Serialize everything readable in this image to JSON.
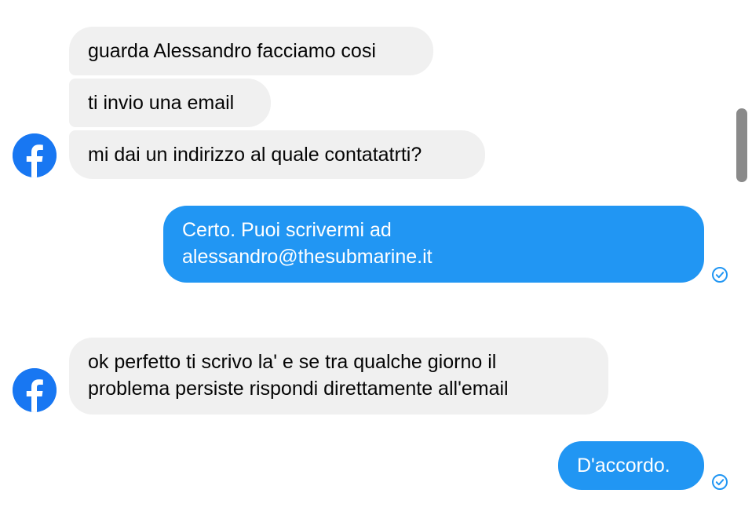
{
  "thread": {
    "messages": [
      {
        "from": "other",
        "text": "guarda Alessandro facciamo cosi"
      },
      {
        "from": "other",
        "text": "ti invio una email"
      },
      {
        "from": "other",
        "text": "mi dai un indirizzo al quale contatatrti?"
      },
      {
        "from": "me",
        "lines": [
          "Certo. Puoi scrivermi ad",
          "alessandro@thesubmarine.it"
        ],
        "status": "sent"
      },
      {
        "from": "other",
        "lines": [
          "ok perfetto ti scrivo la' e se tra qualche giorno il",
          "problema persiste rispondi direttamente all'email"
        ]
      },
      {
        "from": "me",
        "text": "D'accordo.",
        "status": "sent"
      }
    ]
  },
  "avatar": {
    "icon": "facebook-logo-icon",
    "color": "#1877f2"
  },
  "colors": {
    "outgoing": "#2196f3",
    "incoming": "#f0f0f0",
    "check": "#2196f3"
  }
}
